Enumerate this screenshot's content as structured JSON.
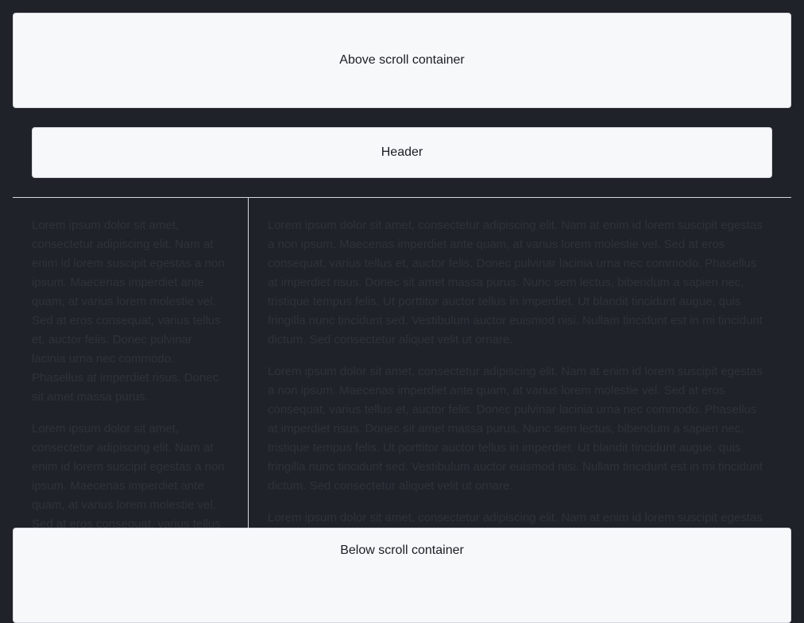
{
  "above": {
    "label": "Above scroll container"
  },
  "header": {
    "label": "Header"
  },
  "below": {
    "label": "Below scroll container"
  },
  "sidebar": {
    "paragraphs": [
      "Lorem ipsum dolor sit amet, consectetur adipiscing elit. Nam at enim id lorem suscipit egestas a non ipsum. Maecenas imperdiet ante quam, at varius lorem molestie vel. Sed at eros consequat, varius tellus et, auctor felis. Donec pulvinar lacinia urna nec commodo. Phasellus at imperdiet risus. Donec sit amet massa purus.",
      "Lorem ipsum dolor sit amet, consectetur adipiscing elit. Nam at enim id lorem suscipit egestas a non ipsum. Maecenas imperdiet ante quam, at varius lorem molestie vel. Sed at eros consequat, varius tellus et, auctor felis."
    ]
  },
  "main": {
    "paragraphs": [
      "Lorem ipsum dolor sit amet, consectetur adipiscing elit. Nam at enim id lorem suscipit egestas a non ipsum. Maecenas imperdiet ante quam, at varius lorem molestie vel. Sed at eros consequat, varius tellus et, auctor felis. Donec pulvinar lacinia urna nec commodo. Phasellus at imperdiet risus. Donec sit amet massa purus. Nunc sem lectus, bibendum a sapien nec, tristique tempus felis. Ut porttitor auctor tellus in imperdiet. Ut blandit tincidunt augue, quis fringilla nunc tincidunt sed. Vestibulum auctor euismod nisi. Nullam tincidunt est in mi tincidunt dictum. Sed consectetur aliquet velit ut ornare.",
      "Lorem ipsum dolor sit amet, consectetur adipiscing elit. Nam at enim id lorem suscipit egestas a non ipsum. Maecenas imperdiet ante quam, at varius lorem molestie vel. Sed at eros consequat, varius tellus et, auctor felis. Donec pulvinar lacinia urna nec commodo. Phasellus at imperdiet risus. Donec sit amet massa purus. Nunc sem lectus, bibendum a sapien nec, tristique tempus felis. Ut porttitor auctor tellus in imperdiet. Ut blandit tincidunt augue, quis fringilla nunc tincidunt sed. Vestibulum auctor euismod nisi. Nullam tincidunt est in mi tincidunt dictum. Sed consectetur aliquet velit ut ornare.",
      "Lorem ipsum dolor sit amet, consectetur adipiscing elit. Nam at enim id lorem suscipit egestas a non ipsum."
    ]
  }
}
